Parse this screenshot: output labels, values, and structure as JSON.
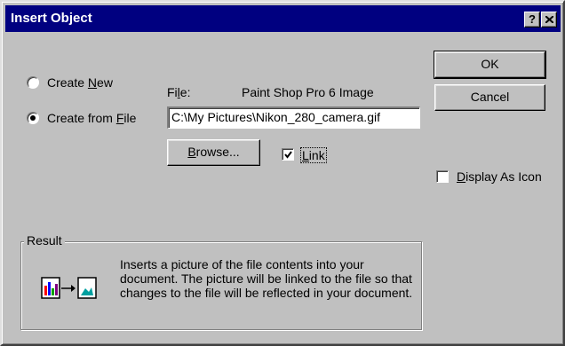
{
  "title": "Insert Object",
  "titlebar": {
    "help_label": "?",
    "help_icon": "question-mark-icon",
    "close_icon": "close-x-icon"
  },
  "radios": {
    "create_new": {
      "pre": "Create ",
      "key": "N",
      "post": "ew",
      "selected": false
    },
    "create_from_file": {
      "pre": "Create from ",
      "key": "F",
      "post": "ile",
      "selected": true
    }
  },
  "file": {
    "label_pre": "Fi",
    "label_key": "l",
    "label_post": "e:",
    "type_name": "Paint Shop Pro 6 Image",
    "value": "C:\\My Pictures\\Nikon_280_camera.gif"
  },
  "browse": {
    "key": "B",
    "post": "rowse..."
  },
  "link": {
    "key": "L",
    "post": "ink",
    "checked": true
  },
  "display_as_icon": {
    "key": "D",
    "post": "isplay As Icon",
    "checked": false
  },
  "buttons": {
    "ok": "OK",
    "cancel": "Cancel"
  },
  "result": {
    "title": "Result",
    "text": "Inserts a picture of the file contents into your document.  The picture will be linked to the file so that changes to the file will be reflected in your document.",
    "icon": "link-picture-icon"
  },
  "colors": {
    "titlebar": "#000080",
    "face": "#c0c0c0"
  }
}
